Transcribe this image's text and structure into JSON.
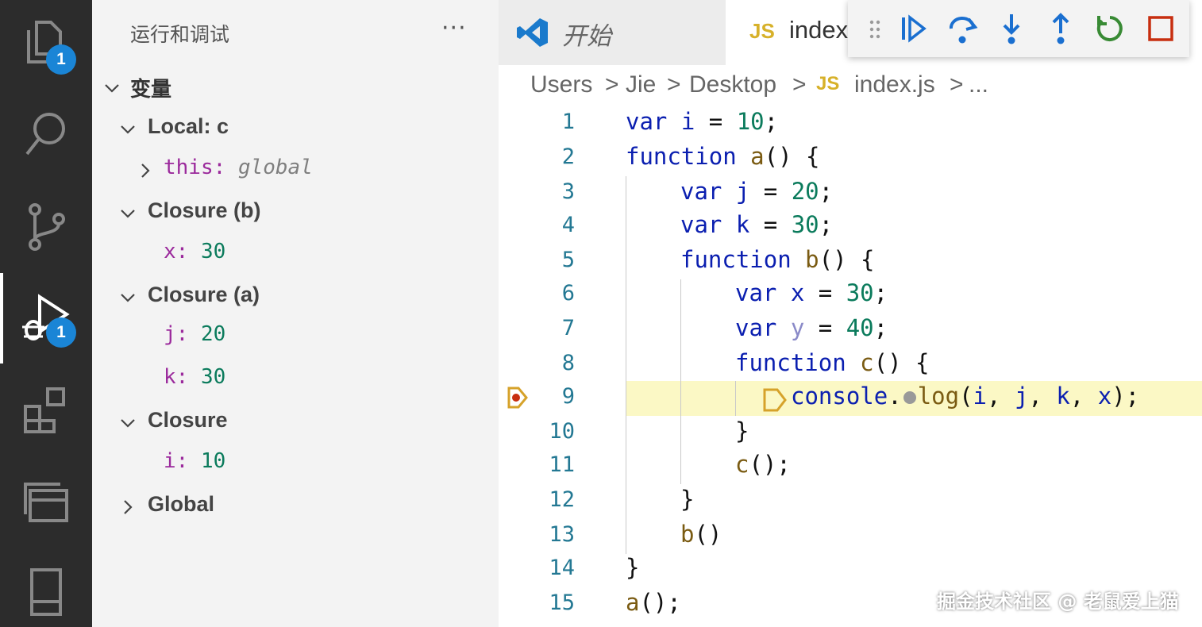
{
  "activity_bar": {
    "explorer_badge": "1",
    "debug_badge": "1"
  },
  "sidebar": {
    "title": "运行和调试",
    "more": "···",
    "section_title": "变量",
    "scopes": [
      {
        "label": "Local: c"
      },
      {
        "label": "Closure (b)"
      },
      {
        "label": "Closure (a)"
      },
      {
        "label": "Closure"
      },
      {
        "label": "Global"
      }
    ],
    "vars": {
      "this_name": "this:",
      "this_value": "global",
      "x_name": "x:",
      "x_value": "30",
      "j_name": "j:",
      "j_value": "20",
      "k_name": "k:",
      "k_value": "30",
      "i_name": "i:",
      "i_value": "10"
    }
  },
  "tabs": {
    "start_label": "开始",
    "index_label": "index",
    "js_badge": "JS"
  },
  "breadcrumb": {
    "items": [
      "Users",
      "Jie",
      "Desktop",
      "index.js",
      "..."
    ],
    "separator": ">",
    "js_badge": "JS"
  },
  "editor": {
    "line_numbers": [
      "1",
      "2",
      "3",
      "4",
      "5",
      "6",
      "7",
      "8",
      "9",
      "10",
      "11",
      "12",
      "13",
      "14",
      "15"
    ],
    "current_line": 9
  },
  "watermark": "掘金技术社区 @ 老鼠爱上猫",
  "colors": {
    "activity_bg": "#2c2c2c",
    "badge": "#1a85d6",
    "keyword": "#0b1fb0",
    "number": "#0b7b5c",
    "function_name": "#7a5b12",
    "variable_name": "#9b2a9c",
    "highlight": "#fbf8c5",
    "stop": "#c72e0f",
    "restart": "#388a34",
    "debug_blue": "#1a6fd0"
  }
}
